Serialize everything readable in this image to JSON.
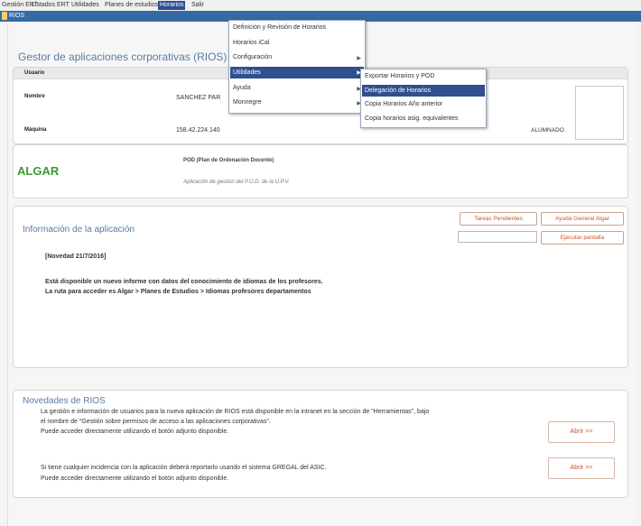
{
  "menubar": {
    "items": [
      "Gestión ERT",
      "Listados ERT",
      "Utilidades",
      "Planes de estudios",
      "Horarios",
      "Salir"
    ]
  },
  "window": {
    "title": "RIOS"
  },
  "app_title": "Gestor de aplicaciones corporativas (RIOS)",
  "user_panel": {
    "header": "Usuario",
    "name_label": "Nombre",
    "name_value": "SANCHEZ PAR",
    "machine_label": "Máquina",
    "machine_value": "158.42.224.140",
    "role_value": "ALUMNADO"
  },
  "horarios_menu": {
    "items": [
      "Definición y Revisión de Horarios",
      "Horarios iCal",
      "Configuración",
      "Utilidades",
      "Ayuda",
      "Monnegre"
    ]
  },
  "utilidades_submenu": {
    "items": [
      "Exportar Horarios y POD",
      "Delegación de Horarios",
      "Copia Horarios Año anterior",
      "Copia horarios asig. equivalentes"
    ]
  },
  "algar": {
    "logo": "ALGAR",
    "title": "POD (Plan de Ordenación Docente)",
    "subtitle": "Aplicación de gestión del P.O.D. de la U.P.V."
  },
  "info": {
    "title": "Información de la aplicación",
    "buttons": {
      "pending": "Tareas Pendientes",
      "help": "Ayuda General Algar",
      "run": "Ejecutar pantalla"
    },
    "input_value": "",
    "news_date": "[Novedad 21/7/2016]",
    "line1": "Está disponible un nuevo informe con datos del conocimiento de idiomas de los profesores.",
    "line2": "La ruta para acceder es Algar > Planes de Estudios > Idiomas profesores departamentos"
  },
  "rios_news": {
    "title": "Novedades de RIOS",
    "p1_line1": "La gestión e información de usuarios para la nueva aplicación de RIOS está disponible en la intranet en la sección de \"Herramientas\", bajo",
    "p1_line2": "el nombre de \"Gestión sobre permisos de acceso a las aplicaciones corporativas\".",
    "p1_line3": "Puede acceder directamente utilizando el botón adjunto disponible.",
    "p2_line1": "Si tiene cualquier incidencia con la aplicación deberá reportarlo usando el sistema GREGAL del ASIC.",
    "p2_line2": "Puede acceder directamente utilizando el botón adjunto disponible.",
    "open_label": "Abrir >>"
  }
}
